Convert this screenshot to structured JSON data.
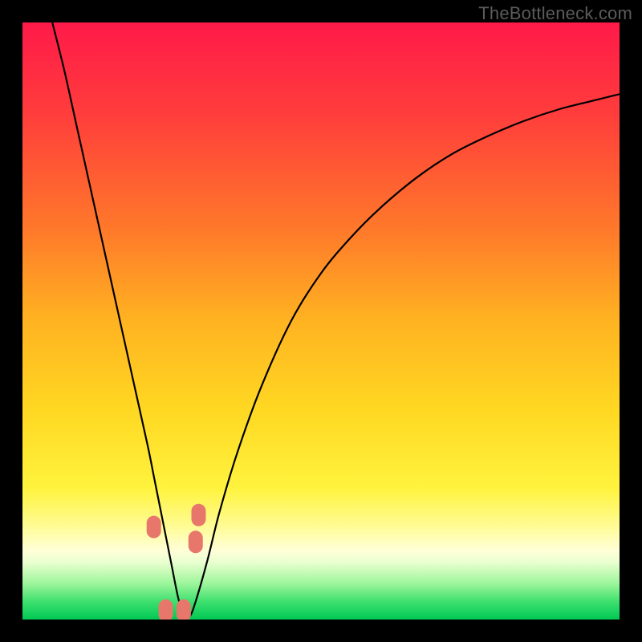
{
  "watermark": "TheBottleneck.com",
  "chart_data": {
    "type": "line",
    "title": "",
    "xlabel": "",
    "ylabel": "",
    "xlim": [
      0,
      100
    ],
    "ylim": [
      0,
      100
    ],
    "grid": false,
    "background_gradient": {
      "stops": [
        {
          "offset": 0.0,
          "color": "#ff1a49"
        },
        {
          "offset": 0.15,
          "color": "#ff3c3c"
        },
        {
          "offset": 0.35,
          "color": "#ff7a2a"
        },
        {
          "offset": 0.5,
          "color": "#ffb321"
        },
        {
          "offset": 0.65,
          "color": "#ffd822"
        },
        {
          "offset": 0.78,
          "color": "#fff33e"
        },
        {
          "offset": 0.84,
          "color": "#fffb8f"
        },
        {
          "offset": 0.885,
          "color": "#ffffd8"
        },
        {
          "offset": 0.905,
          "color": "#e8ffcf"
        },
        {
          "offset": 0.94,
          "color": "#9cf59a"
        },
        {
          "offset": 0.97,
          "color": "#3ee06f"
        },
        {
          "offset": 1.0,
          "color": "#00c853"
        }
      ]
    },
    "series": [
      {
        "name": "curve",
        "color": "#000000",
        "x": [
          5,
          7,
          9,
          11,
          13,
          15,
          17,
          19,
          21,
          22,
          23,
          24,
          25,
          26,
          27,
          28,
          29,
          31,
          33,
          36,
          40,
          45,
          50,
          55,
          60,
          66,
          72,
          78,
          84,
          90,
          96,
          100
        ],
        "y": [
          100,
          92,
          83,
          74,
          65,
          56,
          47,
          38,
          29,
          24,
          19,
          14,
          9,
          4,
          0.5,
          0.5,
          3,
          10,
          18,
          28,
          39,
          50,
          58,
          64,
          69,
          74,
          78,
          81,
          83.5,
          85.5,
          87,
          88
        ]
      }
    ],
    "markers": [
      {
        "name": "marker-1",
        "x": 22.0,
        "y": 15.5,
        "color": "#e8776b"
      },
      {
        "name": "marker-2",
        "x": 24.0,
        "y": 1.5,
        "color": "#e8776b"
      },
      {
        "name": "marker-3",
        "x": 27.0,
        "y": 1.5,
        "color": "#e8776b"
      },
      {
        "name": "marker-4",
        "x": 29.0,
        "y": 13.0,
        "color": "#e8776b"
      },
      {
        "name": "marker-5",
        "x": 29.5,
        "y": 17.5,
        "color": "#e8776b"
      }
    ]
  }
}
